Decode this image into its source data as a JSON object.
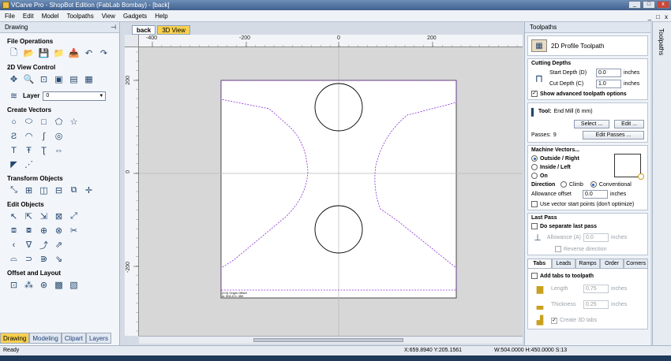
{
  "window": {
    "title": "VCarve Pro - ShopBot Edition (FabLab Bombay) - [back]",
    "controls": [
      "_",
      "□",
      "x"
    ]
  },
  "menu": [
    "File",
    "Edit",
    "Model",
    "Toolpaths",
    "View",
    "Gadgets",
    "Help"
  ],
  "left_panel": {
    "title": "Drawing",
    "sections": {
      "file_operations": "File Operations",
      "view_control": "2D View Control",
      "create_vectors": "Create Vectors",
      "transform_objects": "Transform Objects",
      "edit_objects": "Edit Objects",
      "offset_layout": "Offset and Layout"
    },
    "layer_label": "Layer",
    "layer_value": "0",
    "bottom_tabs": [
      "Drawing",
      "Modeling",
      "Clipart",
      "Layers"
    ]
  },
  "doc_tabs": [
    "back",
    "3D View"
  ],
  "ruler": {
    "top_labels": [
      "-400",
      "-200",
      "0",
      "200"
    ],
    "left_labels": [
      "200",
      "0",
      "-200"
    ]
  },
  "canvas_note": [
    "(0.0) Origin Offset",
    "w: 504.0 h: 450"
  ],
  "right_panel": {
    "title": "Toolpaths",
    "toolpath_name": "2D Profile Toolpath",
    "cutting_depths": {
      "title": "Cutting Depths",
      "start_label": "Start Depth (D)",
      "start_value": "0.0",
      "cut_label": "Cut Depth (C)",
      "cut_value": "1.0",
      "units": "inches",
      "advanced": "Show advanced toolpath options"
    },
    "tool": {
      "label": "Tool:",
      "value": "End Mill (6 mm)",
      "select_btn": "Select ...",
      "edit_btn": "Edit ...",
      "passes_label": "Passes:",
      "passes_value": "9",
      "edit_passes_btn": "Edit Passes ..."
    },
    "machine_vectors": {
      "title": "Machine Vectors...",
      "options": [
        "Outside / Right",
        "Inside / Left",
        "On"
      ],
      "direction_label": "Direction",
      "climb": "Climb",
      "conventional": "Conventional",
      "allowance_label": "Allowance offset",
      "allowance_value": "0.0",
      "units": "inches",
      "start_points": "Use vector start points (don't optimize)"
    },
    "last_pass": {
      "title": "Last Pass",
      "separate": "Do separate last pass",
      "allowance_label": "Allowance (A)",
      "allowance_value": "0.0",
      "units": "inches",
      "reverse": "Reverse direction"
    },
    "tabs": [
      "Tabs",
      "Leads",
      "Ramps",
      "Order",
      "Corners"
    ],
    "tabs_panel": {
      "add_tabs": "Add tabs to toolpath",
      "length_label": "Length",
      "length_value": "0.75",
      "thickness_label": "Thickness",
      "thickness_value": "0.25",
      "units": "inches",
      "create_3d": "Create 3D tabs"
    }
  },
  "side_vertical_tab": "Toolpaths",
  "status": {
    "left": "Ready",
    "coords": "X:659.8940 Y:205.1561",
    "size": "W:504.0000   H:450.0000   S:13"
  }
}
